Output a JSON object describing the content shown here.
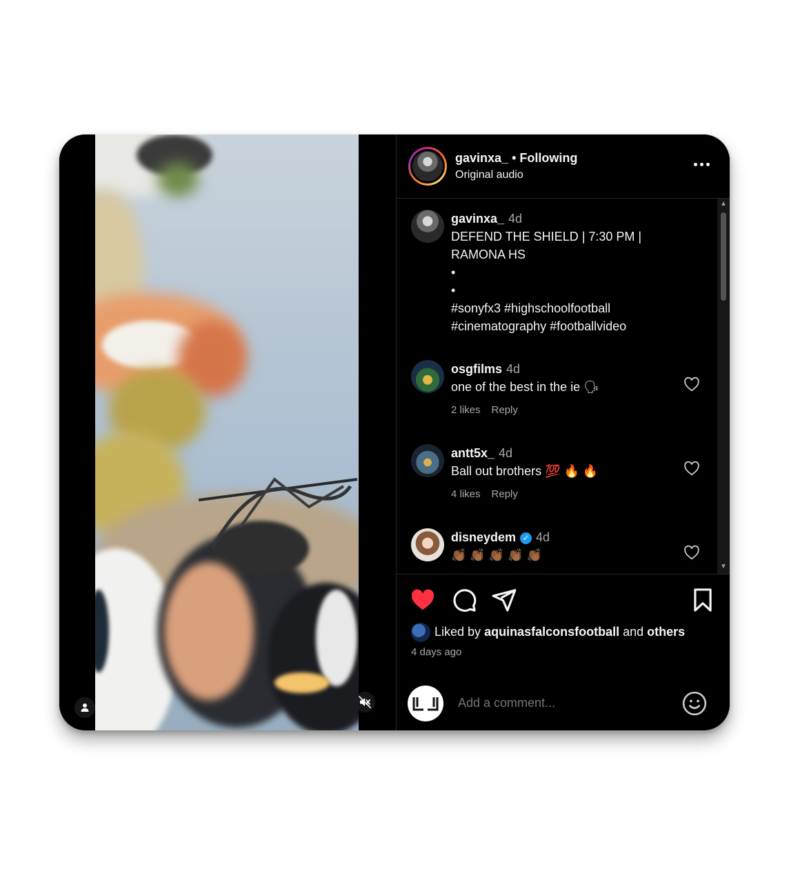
{
  "header": {
    "username": "gavinxa_",
    "follow_status": "• Following",
    "audio": "Original audio",
    "more_icon": "more-horizontal-icon"
  },
  "caption": {
    "username": "gavinxa_",
    "time": "4d",
    "line1": "DEFEND THE SHIELD | 7:30 PM |",
    "line2": "RAMONA HS",
    "bullet1": "•",
    "bullet2": "•",
    "tags1": "#sonyfx3 #highschoolfootball",
    "tags2": "#cinematography #footballvideo"
  },
  "comments": [
    {
      "username": "osgfilms",
      "time": "4d",
      "text": "one of the best in the ie 🗣",
      "likes": "2 likes",
      "reply": "Reply"
    },
    {
      "username": "antt5x_",
      "time": "4d",
      "text": "Ball out brothers 💯 🔥 🔥",
      "likes": "4 likes",
      "reply": "Reply"
    },
    {
      "username": "disneydem",
      "time": "4d",
      "text": "👏🏾 👏🏾 👏🏾 👏🏾 👏🏾",
      "verified": true
    }
  ],
  "actions": {
    "like_state": "liked",
    "like_color": "#ff3040",
    "liked_by_prefix": "Liked by",
    "liked_by_user": "aquinasfalconsfootball",
    "liked_by_and": "and",
    "liked_by_others": "others",
    "posted_ago": "4 days ago"
  },
  "add_comment": {
    "placeholder": "Add a comment...",
    "emoji_icon": "smiley-icon"
  },
  "video": {
    "mute_icon": "muted-speaker-icon",
    "user_tag_icon": "person-tag-icon"
  }
}
